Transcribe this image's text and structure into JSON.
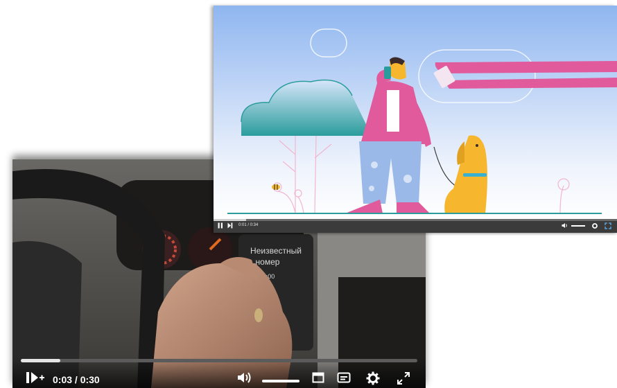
{
  "back_player": {
    "phone_caller_line1": "Неизвестный",
    "phone_caller_line2": "номер",
    "phone_call_timer": "00:00",
    "progress_fraction": 0.1,
    "time_display": "0:03 / 0:30",
    "controls": [
      "play-pause",
      "volume",
      "miniplayer",
      "subtitles",
      "settings",
      "fullscreen"
    ]
  },
  "front_player": {
    "progress_fraction": 0.08,
    "time_display": "0:01 / 0:34",
    "controls": [
      "play-pause",
      "next",
      "volume",
      "settings",
      "fullscreen"
    ]
  },
  "colors": {
    "sky_top": "#8fb6f0",
    "sky_bottom": "#ffffff",
    "jacket": "#e05a9c",
    "pants": "#9ab8e8",
    "dog": "#f6b72e",
    "banner": "#e05a9c",
    "teal": "#2a9c9c"
  }
}
